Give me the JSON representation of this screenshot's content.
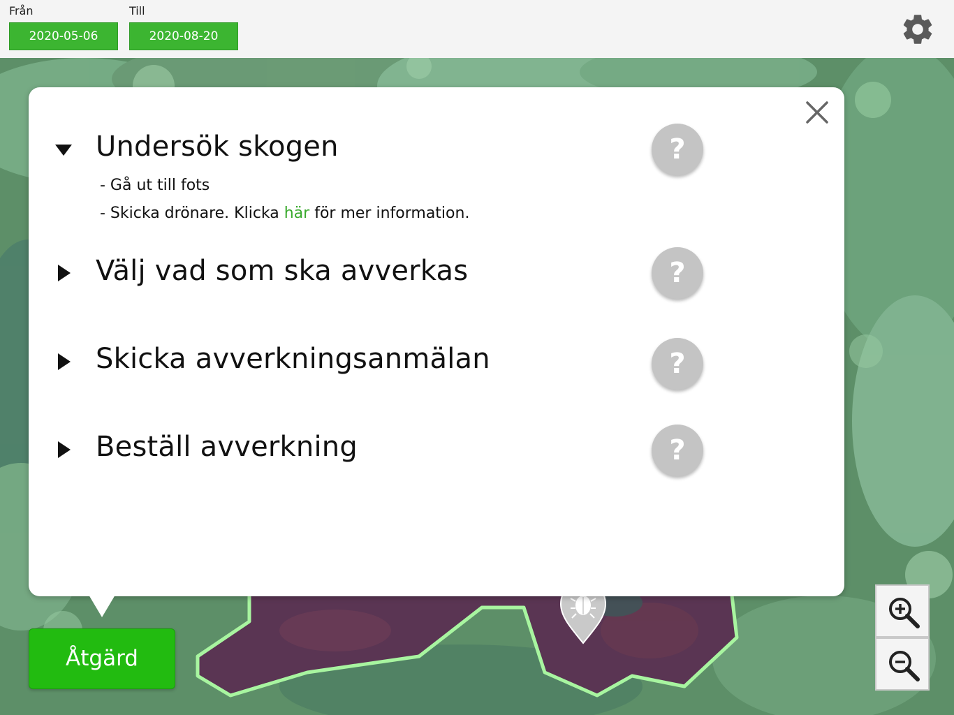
{
  "topbar": {
    "from_label": "Från",
    "from_date": "2020-05-06",
    "to_label": "Till",
    "to_date": "2020-08-20",
    "settings_icon": "gear-icon"
  },
  "panel": {
    "close_icon": "close-icon",
    "steps": [
      {
        "title": "Undersök skogen",
        "expanded": true,
        "details": [
          {
            "text": "- Gå ut till fots"
          },
          {
            "prefix": "- Skicka drönare. Klicka ",
            "link": "här",
            "suffix": " för mer information."
          }
        ],
        "help": "?"
      },
      {
        "title": "Välj vad som ska avverkas",
        "expanded": false,
        "help": "?"
      },
      {
        "title": "Skicka avverkningsanmälan",
        "expanded": false,
        "help": "?"
      },
      {
        "title": "Beställ avverkning",
        "expanded": false,
        "help": "?"
      }
    ]
  },
  "action_button": {
    "label": "Åtgärd"
  },
  "zoom": {
    "in_icon": "zoom-in-icon",
    "out_icon": "zoom-out-icon"
  },
  "map": {
    "marker_icon": "bug-marker-icon",
    "area_outline_color": "#a8f5a0"
  },
  "colors": {
    "accent_green": "#3cb531",
    "action_green": "#22bb10",
    "link_green": "#3aaa2e",
    "help_gray": "#c4c4c4"
  }
}
